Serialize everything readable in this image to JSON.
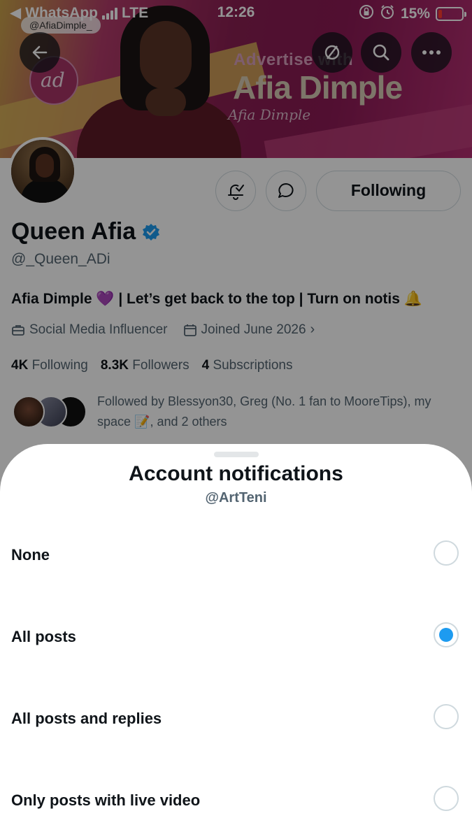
{
  "status_bar": {
    "back_app": "WhatsApp",
    "network": "LTE",
    "time": "12:26",
    "battery": "15%",
    "battery_level": 0.15
  },
  "banner": {
    "handle_tag": "@AfiaDimple_",
    "advertise_text": "Advertise with",
    "brand_name": "Afia Dimple",
    "logo_text": "ad"
  },
  "profile": {
    "name": "Queen Afia",
    "handle": "@_Queen_ADi",
    "bio": "Afia Dimple 💜 | Let’s get back to the top | Turn on notis 🔔",
    "category": "Social Media Influencer",
    "joined": "Joined June 2026",
    "following_count": "4K",
    "following_label": "Following",
    "followers_count": "8.3K",
    "followers_label": "Followers",
    "subscriptions_count": "4",
    "subscriptions_label": "Subscriptions",
    "followed_by": "Followed by Blessyon30, Greg (No. 1 fan to MooreTips), my space 📝, and 2 others",
    "following_button": "Following"
  },
  "sheet": {
    "title": "Account notifications",
    "subtitle": "@ArtTeni",
    "options": [
      {
        "label": "None",
        "selected": false
      },
      {
        "label": "All posts",
        "selected": true
      },
      {
        "label": "All posts and replies",
        "selected": false
      },
      {
        "label": "Only posts with live video",
        "selected": false
      }
    ]
  },
  "colors": {
    "accent": "#1d9bf0",
    "verified": "#1d9bf0",
    "text_primary": "#0f1419",
    "text_secondary": "#536471",
    "battery_low": "#ff3b30"
  },
  "icons": {
    "back": "back-arrow-icon",
    "hide": "eye-slash-icon",
    "search": "search-icon",
    "more": "more-dots-icon",
    "notify": "bell-add-icon",
    "message": "message-bubble-icon",
    "verified": "verified-badge-icon",
    "category": "briefcase-icon",
    "joined": "calendar-icon"
  }
}
